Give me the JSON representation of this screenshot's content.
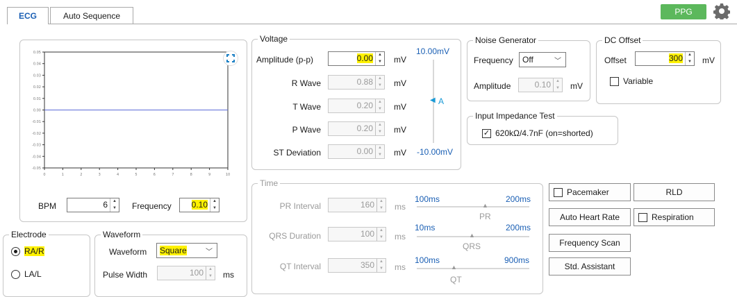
{
  "tabs": [
    {
      "label": "ECG",
      "active": true
    },
    {
      "label": "Auto Sequence",
      "active": false
    }
  ],
  "header": {
    "ppg_label": "PPG",
    "settings_icon": "gear-icon"
  },
  "plot": {
    "y_ticks": [
      "0.05",
      "0.04",
      "0.03",
      "0.02",
      "0.01",
      "0.00",
      "-0.01",
      "-0.02",
      "-0.03",
      "-0.04",
      "-0.05"
    ],
    "x_ticks": [
      "0",
      "1",
      "2",
      "3",
      "4",
      "5",
      "6",
      "7",
      "8",
      "9",
      "10"
    ],
    "expand_icon": "expand-icon",
    "line_color": "#5b6bd8"
  },
  "bpm": {
    "label": "BPM",
    "value": "6"
  },
  "frequency": {
    "label": "Frequency",
    "value": "0.10"
  },
  "voltage": {
    "title": "Voltage",
    "rows": [
      {
        "label": "Amplitude (p-p)",
        "value": "0.00",
        "unit": "mV"
      },
      {
        "label": "R Wave",
        "value": "0.88",
        "unit": "mV"
      },
      {
        "label": "T Wave",
        "value": "0.20",
        "unit": "mV"
      },
      {
        "label": "P Wave",
        "value": "0.20",
        "unit": "mV"
      },
      {
        "label": "ST Deviation",
        "value": "0.00",
        "unit": "mV"
      }
    ],
    "scale_top": "10.00mV",
    "scale_bottom": "-10.00mV",
    "marker": "A"
  },
  "noise": {
    "title": "Noise Generator",
    "frequency_label": "Frequency",
    "frequency_value": "Off",
    "amplitude_label": "Amplitude",
    "amplitude_value": "0.10",
    "amplitude_unit": "mV"
  },
  "dc_offset": {
    "title": "DC Offset",
    "offset_label": "Offset",
    "offset_value": "300",
    "offset_unit": "mV",
    "variable_label": "Variable"
  },
  "impedance": {
    "title": "Input Impedance Test",
    "checkbox_label": "620kΩ/4.7nF (on=shorted)"
  },
  "time": {
    "title": "Time",
    "rows": [
      {
        "label": "PR Interval",
        "value": "160",
        "unit": "ms",
        "min": "100ms",
        "max": "200ms",
        "marker": "PR"
      },
      {
        "label": "QRS Duration",
        "value": "100",
        "unit": "ms",
        "min": "10ms",
        "max": "200ms",
        "marker": "QRS"
      },
      {
        "label": "QT Interval",
        "value": "350",
        "unit": "ms",
        "min": "100ms",
        "max": "900ms",
        "marker": "QT"
      }
    ]
  },
  "right_buttons": {
    "pacemaker": "Pacemaker",
    "rld": "RLD",
    "auto_heart_rate": "Auto Heart Rate",
    "respiration": "Respiration",
    "frequency_scan": "Frequency Scan",
    "std_assistant": "Std. Assistant"
  },
  "electrode": {
    "title": "Electrode",
    "options": [
      "RA/R",
      "LA/L"
    ],
    "selected": "RA/R"
  },
  "waveform": {
    "title": "Waveform",
    "waveform_label": "Waveform",
    "waveform_value": "Square",
    "pulse_label": "Pulse Width",
    "pulse_value": "100",
    "pulse_unit": "ms"
  },
  "colors": {
    "highlight": "#fff200",
    "ppg_green": "#5cb85c",
    "tab_blue": "#1a5fb4"
  }
}
